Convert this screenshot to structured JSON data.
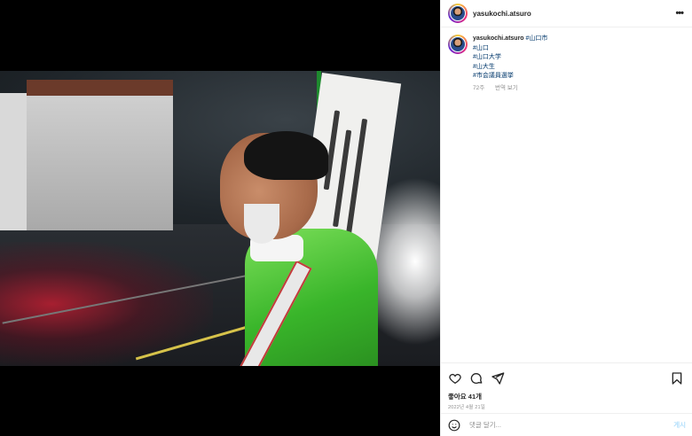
{
  "header": {
    "username": "yasukochi.atsuro",
    "more_icon": "more-icon"
  },
  "caption": {
    "username": "yasukochi.atsuro",
    "first_tag": "#山口市",
    "tags": [
      "#山口",
      "#山口大学",
      "#山大生",
      "#市会議員選挙"
    ],
    "time_ago": "72주",
    "translate_label": "번역 보기"
  },
  "post": {
    "photo_alt": "Man in green jacket speaking in the rain at night",
    "icons": [
      "heart-icon",
      "comment-icon",
      "share-icon",
      "bookmark-icon"
    ]
  },
  "likes": "좋아요 41개",
  "date": "2022년 4월 21일",
  "comment_box": {
    "placeholder": "댓글 달기...",
    "post_label": "게시"
  },
  "colors": {
    "link": "#00376b",
    "muted": "#8e8e8e",
    "post_disabled": "#b2dffc",
    "jacket": "#39b52a"
  }
}
